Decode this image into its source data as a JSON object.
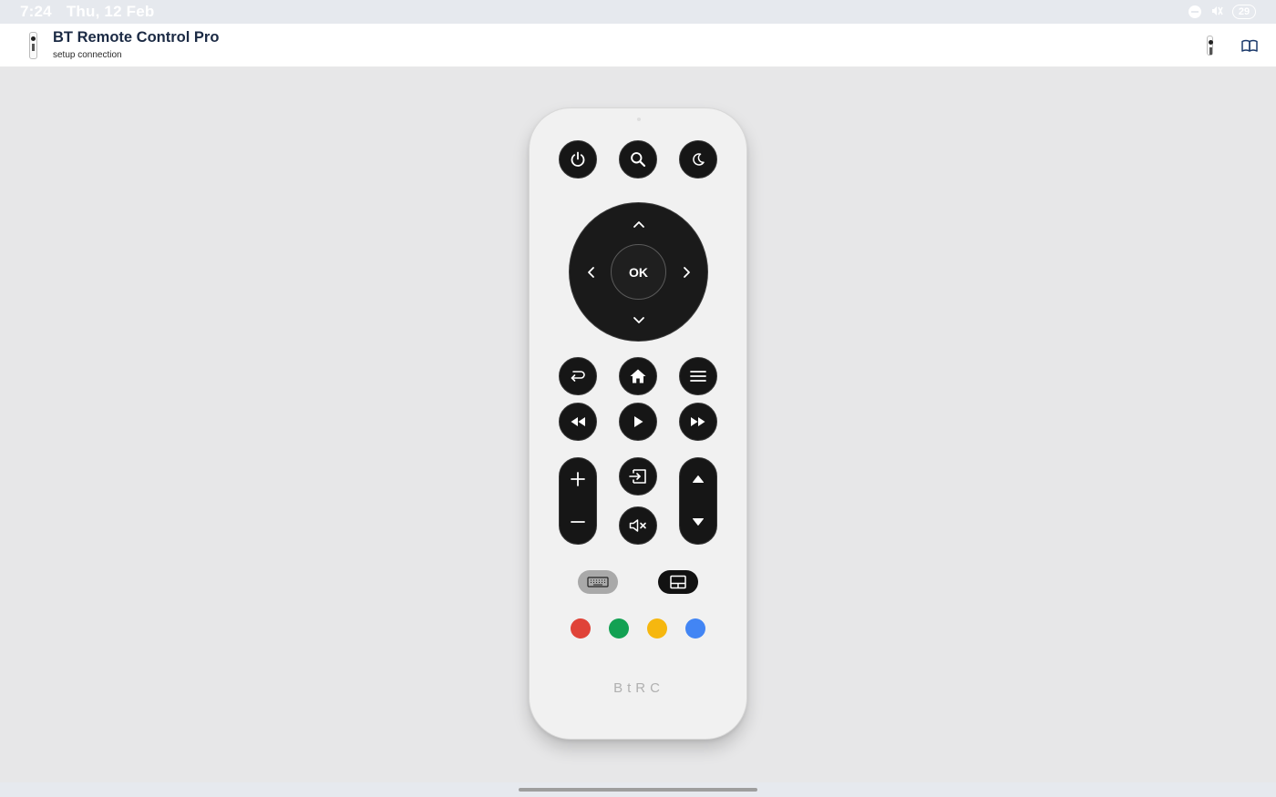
{
  "status_bar": {
    "time": "7:24",
    "date": "Thu, 12 Feb",
    "battery": "29"
  },
  "app_bar": {
    "title": "BT Remote Control Pro",
    "subtitle": "setup connection",
    "icons": [
      "remote-icon",
      "remote-icon",
      "book-icon"
    ]
  },
  "remote": {
    "ok_label": "OK",
    "brand": "BtRC",
    "top_row": [
      "power-icon",
      "search-icon",
      "moon-icon"
    ],
    "nav_row": [
      "back-icon",
      "home-icon",
      "menu-icon"
    ],
    "media_row": [
      "rewind-icon",
      "play-icon",
      "fast-forward-icon"
    ],
    "middle_column": [
      "input-source-icon",
      "mute-icon"
    ],
    "volume_rocker": [
      "plus-icon",
      "minus-icon"
    ],
    "channel_rocker": [
      "triangle-up-icon",
      "triangle-down-icon"
    ],
    "pills": [
      "keyboard-icon",
      "touchpad-icon"
    ],
    "color_buttons": [
      {
        "name": "red",
        "color": "#e04338"
      },
      {
        "name": "green",
        "color": "#13a153"
      },
      {
        "name": "yellow",
        "color": "#f6b70f"
      },
      {
        "name": "blue",
        "color": "#4285f4"
      }
    ]
  },
  "colors": {
    "button_fill": "#161616",
    "remote_body": "#f1f1f1",
    "background": "#e7e7e8",
    "title_text": "#1b2a44"
  }
}
